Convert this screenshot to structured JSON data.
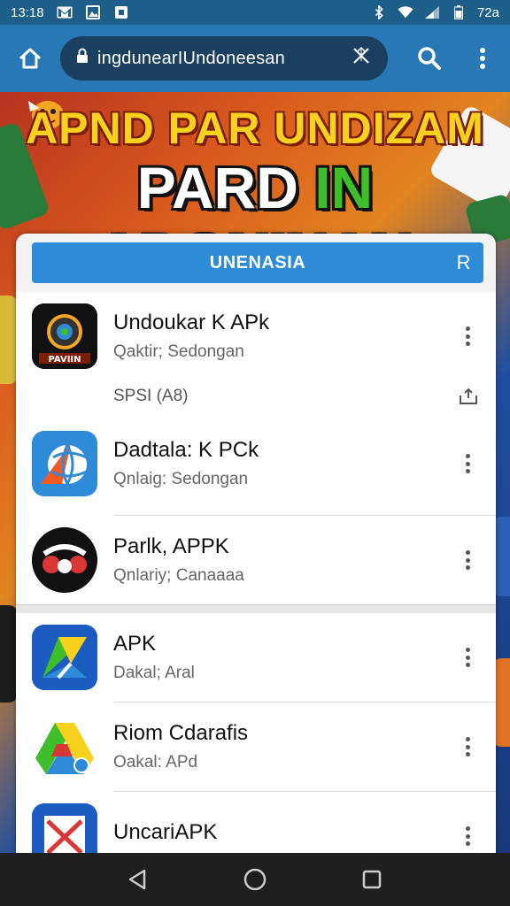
{
  "status_bar": {
    "time": "13:18",
    "battery_text": "72a",
    "left_icons": [
      "gmail-icon",
      "gallery-icon",
      "notification-icon"
    ],
    "right_icons": [
      "bluetooth-icon",
      "wifi-icon",
      "signal-icon",
      "battery-icon"
    ]
  },
  "browser": {
    "url": "ingdunearIUndoneesan",
    "icons": [
      "home-icon",
      "lock-icon",
      "clear-icon",
      "search-icon",
      "overflow-icon"
    ]
  },
  "banner": {
    "line1": "APND PAR UNDIZAM",
    "line2_start": "PARD ",
    "line2_highlight": "IN",
    "line2_end": " ADONINAN",
    "colors": {
      "line1": "#f7d11e",
      "highlight": "#3fbd2a"
    }
  },
  "search": {
    "label": "UNENASIA",
    "icon_text": "R"
  },
  "apps_top": [
    {
      "title": "Undoukar K APk",
      "subtitle": "Qaktir; Sedongan",
      "icon": "camera-lens-icon",
      "icon_label": "PAVIIN"
    }
  ],
  "section": {
    "label": "SPSI (A8)",
    "icon": "share-icon"
  },
  "apps_middle": [
    {
      "title": "Dadtala: K PCk",
      "subtitle": "Qnlaig: Sedongan",
      "icon": "globe-colorful-icon"
    },
    {
      "title": "Parlk, APPK",
      "subtitle": "Qnlariy; Canaaaa",
      "icon": "red-eye-icon"
    }
  ],
  "apps_bottom": [
    {
      "title": "APK",
      "subtitle": "Dakal; Aral",
      "icon": "maps-icon"
    },
    {
      "title": "Riom Cdarafis",
      "subtitle": "Oakal: APd",
      "icon": "drive-icon"
    },
    {
      "title": "UncariAPK",
      "subtitle": "",
      "icon": "blue-app-icon"
    }
  ],
  "nav_bar": {
    "icons": [
      "back-icon",
      "home-circle-icon",
      "recents-icon"
    ]
  }
}
